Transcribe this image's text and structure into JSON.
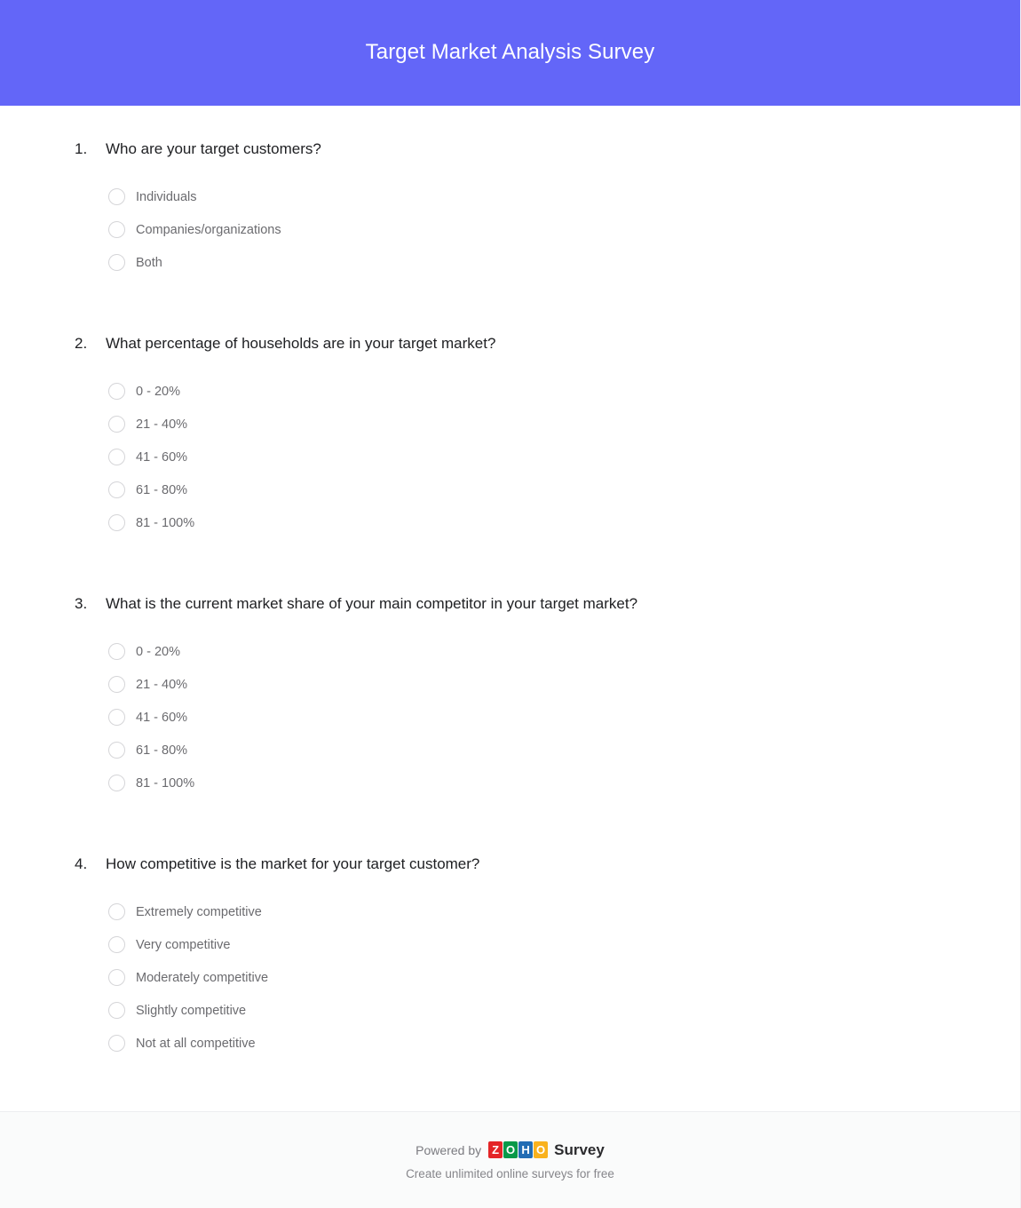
{
  "header": {
    "title": "Target Market Analysis Survey",
    "background_color": "#6366f8",
    "title_color": "#ffffff"
  },
  "questions": [
    {
      "number": "1.",
      "text": "Who are your target customers?",
      "type": "radio",
      "options": [
        "Individuals",
        "Companies/organizations",
        "Both"
      ]
    },
    {
      "number": "2.",
      "text": "What percentage of households are in your target market?",
      "type": "radio",
      "options": [
        "0 - 20%",
        "21 - 40%",
        "41 - 60%",
        "61 - 80%",
        "81 - 100%"
      ]
    },
    {
      "number": "3.",
      "text": "What is the current market share of your main competitor in your target market?",
      "type": "radio",
      "options": [
        "0 - 20%",
        "21 - 40%",
        "41 - 60%",
        "61 - 80%",
        "81 - 100%"
      ]
    },
    {
      "number": "4.",
      "text": "How competitive is the market for your target customer?",
      "type": "radio",
      "options": [
        "Extremely competitive",
        "Very competitive",
        "Moderately competitive",
        "Slightly competitive",
        "Not at all competitive"
      ]
    }
  ],
  "footer": {
    "powered_by": "Powered by",
    "brand_tiles": [
      {
        "letter": "Z",
        "color": "#e42527"
      },
      {
        "letter": "O",
        "color": "#089949"
      },
      {
        "letter": "H",
        "color": "#226db4"
      },
      {
        "letter": "O",
        "color": "#f9b21d"
      }
    ],
    "product": "Survey",
    "tagline": "Create unlimited online surveys for free"
  }
}
